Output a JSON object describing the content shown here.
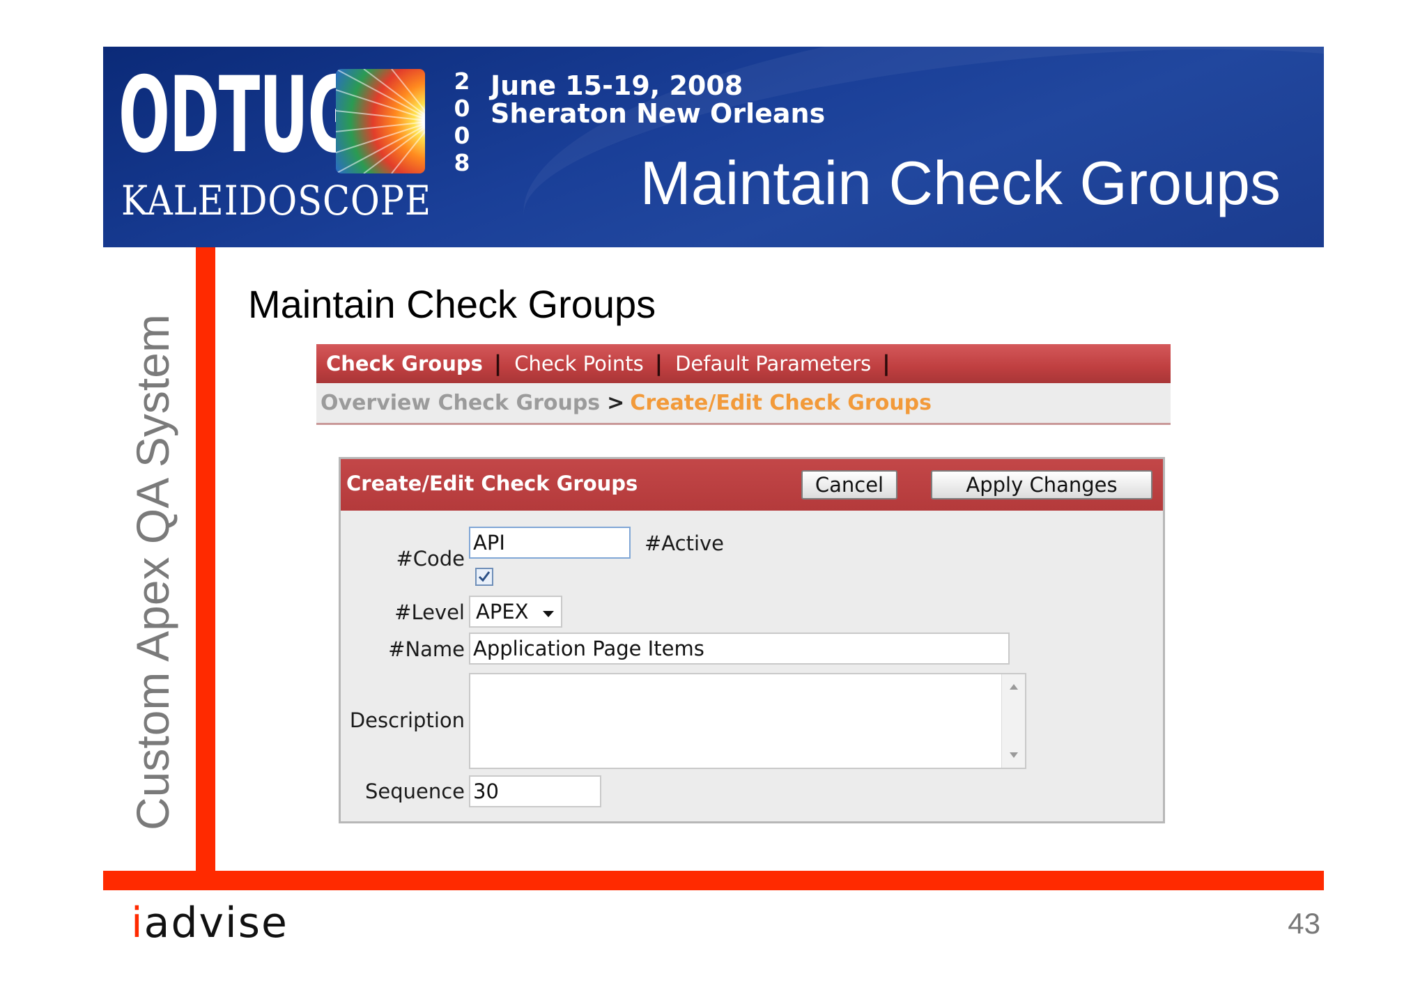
{
  "banner": {
    "logo_text": "ODTUG",
    "logo_subtext": "KALEIDOSCOPE",
    "year_digits": [
      "2",
      "0",
      "0",
      "8"
    ],
    "date": "June 15-19, 2008",
    "venue": "Sheraton New Orleans",
    "title": "Maintain Check Groups"
  },
  "side_label": "Custom Apex QA System",
  "slide_heading": "Maintain Check Groups",
  "app": {
    "nav": {
      "tabs": [
        {
          "label": "Check Groups",
          "active": true
        },
        {
          "label": "Check Points",
          "active": false
        },
        {
          "label": "Default Parameters",
          "active": false
        }
      ],
      "separator": "|"
    },
    "breadcrumb": {
      "parent": "Overview Check Groups",
      "separator": ">",
      "current": "Create/Edit Check Groups"
    },
    "region": {
      "title": "Create/Edit Check Groups",
      "cancel_label": "Cancel",
      "apply_label": "Apply Changes",
      "form": {
        "code": {
          "label": "#Code",
          "value": "API"
        },
        "active": {
          "label": "#Active",
          "checked": true
        },
        "level": {
          "label": "#Level",
          "value": "APEX"
        },
        "name": {
          "label": "#Name",
          "value": "Application Page Items"
        },
        "description": {
          "label": "Description",
          "value": ""
        },
        "sequence": {
          "label": "Sequence",
          "value": "30"
        }
      }
    }
  },
  "footer": {
    "brand_i": "i",
    "brand_rest": "advise",
    "page_number": "43"
  },
  "colors": {
    "banner_blue": "#1a3f98",
    "frame_red": "#ff2a00",
    "nav_red": "#bf3f40",
    "breadcrumb_orange": "#f29a3a"
  }
}
